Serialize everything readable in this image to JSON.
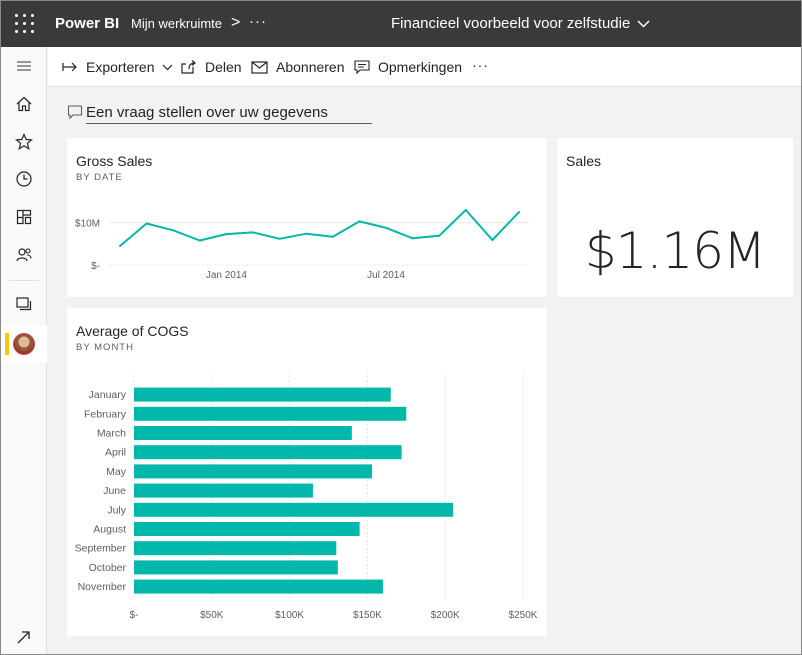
{
  "topbar": {
    "brand": "Power BI",
    "workspace": "Mijn werkruimte",
    "chevron": ">",
    "more": "···",
    "report_title": "Financieel voorbeeld voor zelfstudie"
  },
  "actions": {
    "export": "Exporteren",
    "share": "Delen",
    "subscribe": "Abonneren",
    "comments": "Opmerkingen",
    "more": "···"
  },
  "qna": {
    "placeholder": "Een vraag stellen over uw gegevens"
  },
  "tiles": {
    "gross_sales": {
      "title": "Gross Sales",
      "subtitle": "BY DATE"
    },
    "sales": {
      "title": "Sales",
      "value": "$1.16M"
    },
    "cogs": {
      "title": "Average of COGS",
      "subtitle": "BY MONTH"
    }
  },
  "colors": {
    "accent": "#01b8aa",
    "topbar": "#3b3a39",
    "active": "#f2c811"
  },
  "chart_data": [
    {
      "type": "line",
      "title": "Gross Sales",
      "subtitle": "BY DATE",
      "x": [
        "2013-09",
        "2013-10",
        "2013-11",
        "2013-12",
        "2014-01",
        "2014-02",
        "2014-03",
        "2014-04",
        "2014-05",
        "2014-06",
        "2014-07",
        "2014-08",
        "2014-09",
        "2014-10",
        "2014-11",
        "2014-12"
      ],
      "series": [
        {
          "values": [
            4.5,
            9.8,
            8.2,
            5.8,
            7.3,
            7.7,
            6.2,
            7.4,
            6.7,
            10.3,
            8.8,
            6.3,
            6.9,
            13.0,
            5.9,
            12.5
          ]
        }
      ],
      "xtick_labels": [
        "Jan 2014",
        "Jul 2014"
      ],
      "xtick_positions": [
        "2014-01",
        "2014-07"
      ],
      "ytick_labels": [
        "$-",
        "$10M"
      ],
      "yticks": [
        0,
        10
      ],
      "yunit": "M",
      "ylim": [
        0,
        13
      ],
      "grid": true
    },
    {
      "type": "bar",
      "orientation": "horizontal",
      "title": "Average of COGS",
      "subtitle": "BY MONTH",
      "categories": [
        "January",
        "February",
        "March",
        "April",
        "May",
        "June",
        "July",
        "August",
        "September",
        "October",
        "November"
      ],
      "values": [
        165000,
        175000,
        140000,
        172000,
        153000,
        115000,
        205000,
        145000,
        130000,
        131000,
        160000
      ],
      "xtick_labels": [
        "$-",
        "$50K",
        "$100K",
        "$150K",
        "$200K",
        "$250K"
      ],
      "xticks": [
        0,
        50000,
        100000,
        150000,
        200000,
        250000
      ],
      "xlim": [
        0,
        250000
      ],
      "grid": true
    }
  ]
}
